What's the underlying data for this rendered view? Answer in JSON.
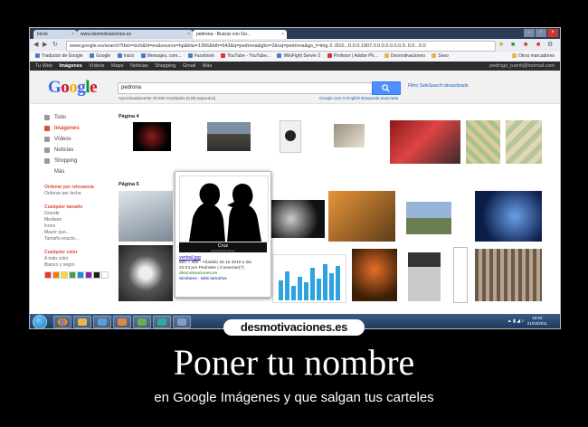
{
  "browser": {
    "tabs": [
      {
        "label": "Inicio"
      },
      {
        "label": "www.desmotivaciones.es"
      },
      {
        "label": "pedrona - Buscar con Go..."
      }
    ],
    "url": "www.google.es/search?tbm=isch&hl=es&source=hp&biw=1366&bih=643&q=pedrona&gbv=2&oq=pedrona&gs_l=img.3..0l10...0.0.0.1907.0.0.0.0.0.0.0.0..0.0...0.0"
  },
  "bookmarks": [
    {
      "label": "Traductor de Google"
    },
    {
      "label": "Google"
    },
    {
      "label": "Inicio"
    },
    {
      "label": "Mensajes, com..."
    },
    {
      "label": "Facebook"
    },
    {
      "label": "YouTube - YouTube..."
    },
    {
      "label": "WikiFight Server 2"
    },
    {
      "label": "Profesor | Adobe Ph..."
    },
    {
      "label": "Desmotivaciones"
    },
    {
      "label": "Sexo"
    },
    {
      "label": "Otros marcadores"
    }
  ],
  "google_bar": {
    "items": [
      {
        "label": "Tu Web"
      },
      {
        "label": "Imágenes"
      },
      {
        "label": "Vídeos"
      },
      {
        "label": "Maps"
      },
      {
        "label": "Noticias"
      },
      {
        "label": "Shopping"
      },
      {
        "label": "Gmail"
      },
      {
        "label": "Más"
      }
    ],
    "user": "pedrogo_tuenti@hotmail.com"
  },
  "search": {
    "logo": "Google",
    "query": "pedrona",
    "safe_search": "Filtro SafeSearch desactivado",
    "stats": "Aproximadamente 29.500 resultados (0,08 segundos)",
    "right_links": "Google.com in English   Búsqueda avanzada"
  },
  "sidebar": {
    "items": [
      {
        "label": "Todo"
      },
      {
        "label": "Imágenes"
      },
      {
        "label": "Vídeos"
      },
      {
        "label": "Noticias"
      },
      {
        "label": "Shopping"
      },
      {
        "label": "Más"
      }
    ],
    "group1": {
      "heading": "Ordenar por relevancia",
      "option": "Ordenar por fecha"
    },
    "group2": {
      "heading": "Cualquier tamaño",
      "options": [
        "Grande",
        "Mediano",
        "Icono",
        "Mayor que...",
        "Tamaño exacto..."
      ]
    },
    "group3": {
      "heading": "Cualquier color",
      "options": [
        "A todo color",
        "Blanco y negro"
      ]
    },
    "swatches": [
      "#e53935",
      "#f57c00",
      "#fdd835",
      "#43a047",
      "#1e88e5",
      "#8e24aa",
      "#212121",
      "#ffffff"
    ]
  },
  "results": {
    "page4_label": "Página 4",
    "page5_label": "Página 5"
  },
  "preview": {
    "caption": "Cruz",
    "caption_sub": "desmotivaciones.es",
    "filename": "verbal.jpg",
    "line1": "500 × 480 - Añadido 25 10 2010 a las",
    "line2": "22:24 por PedroMe | Comentar(?)",
    "source": "desmotivaciones.es",
    "links": "Similares · Más tamaños"
  },
  "taskbar": {
    "time": "16:04",
    "date": "21/04/2011"
  },
  "watermark": "desmotivaciones.es",
  "poster": {
    "title": "Poner tu nombre",
    "subtitle": "en Google Imágenes y que salgan tus carteles"
  }
}
